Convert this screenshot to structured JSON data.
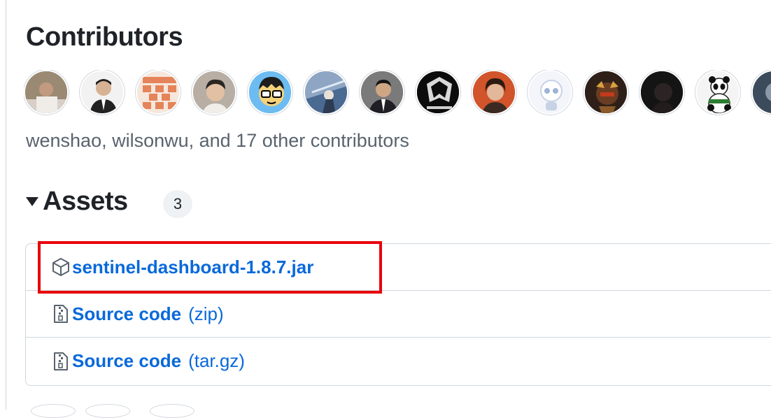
{
  "contributors": {
    "heading": "Contributors",
    "summary": "wenshao, wilsonwu, and 17 other contributors",
    "avatars": [
      {
        "name": "avatar-1",
        "color": "#8a7a6a"
      },
      {
        "name": "avatar-2",
        "color": "#e9e9e9"
      },
      {
        "name": "avatar-3",
        "color": "#f3d9c8"
      },
      {
        "name": "avatar-4",
        "color": "#a89a8e"
      },
      {
        "name": "avatar-5",
        "color": "#5fb4ef"
      },
      {
        "name": "avatar-6",
        "color": "#6f8fb8"
      },
      {
        "name": "avatar-7",
        "color": "#5b5b5b"
      },
      {
        "name": "avatar-8",
        "color": "#111111"
      },
      {
        "name": "avatar-9",
        "color": "#c84a1e"
      },
      {
        "name": "avatar-10",
        "color": "#eef1f8"
      },
      {
        "name": "avatar-11",
        "color": "#3b2a20"
      },
      {
        "name": "avatar-12",
        "color": "#1a1a1a"
      },
      {
        "name": "avatar-13",
        "color": "#f2f2f2"
      },
      {
        "name": "avatar-14",
        "color": "#2b3a4a"
      }
    ]
  },
  "assets": {
    "heading": "Assets",
    "count": "3",
    "items": [
      {
        "label": "sentinel-dashboard-1.8.7.jar",
        "suffix": "",
        "icon": "package-icon"
      },
      {
        "label": "Source code",
        "suffix": "(zip)",
        "icon": "file-zip-icon"
      },
      {
        "label": "Source code",
        "suffix": "(tar.gz)",
        "icon": "file-zip-icon"
      }
    ]
  },
  "colors": {
    "link": "#0969da",
    "highlight": "#e8000b",
    "border": "#d0d7de",
    "muted": "#59636e"
  }
}
